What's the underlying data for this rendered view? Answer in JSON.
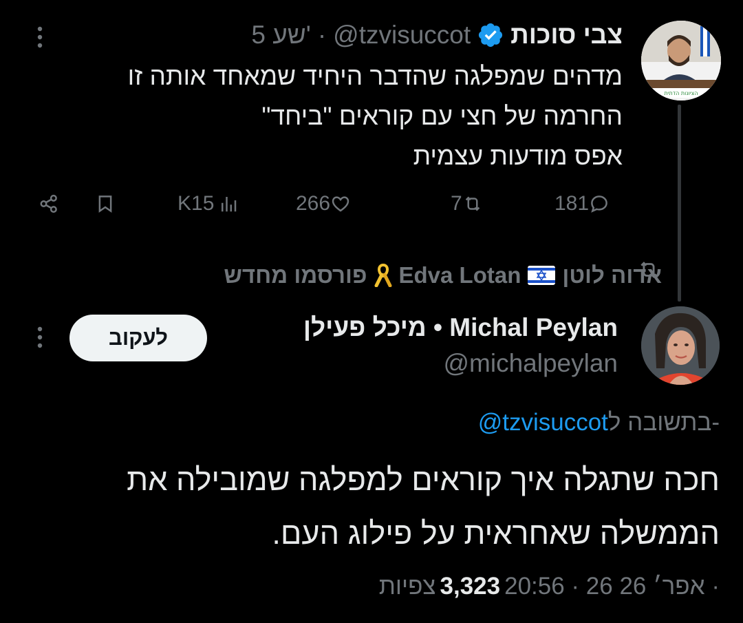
{
  "tweet1": {
    "author_name": "צבי סוכות",
    "handle": "@tzvisuccot",
    "time": "5 שע'",
    "separator": "·",
    "avatar_icon": "person-avatar",
    "verified_icon": "verified-badge-icon",
    "body_lines": [
      "מדהים שמפלגה שהדבר היחיד שמאחד אותה זו",
      "החרמה של חצי עם קוראים \"ביחד\"",
      "אפס מודעות עצמית"
    ],
    "actions": {
      "replies": "181",
      "retweets": "7",
      "likes": "266",
      "views": "K15"
    }
  },
  "repost_banner": {
    "text_he": "אדוה לוטן",
    "text_en": "Edva Lotan",
    "suffix": "פורסמו מחדש",
    "flag_icon": "israel-flag-icon",
    "ribbon_icon": "yellow-ribbon-icon"
  },
  "tweet2": {
    "author_name": "מיכל פעילן • Michal Peylan",
    "handle": "@michalpeylan",
    "follow_label": "לעקוב",
    "reply_prefix": "בתשובה ל-",
    "reply_mention": "@tzvisuccot",
    "body_lines": [
      "חכה שתגלה איך קוראים למפלגה שמובילה את",
      "הממשלה שאחראית על פילוג העם."
    ],
    "meta_time": "20:56 · 26 אפר׳ 26 ·",
    "views_count": "3,323",
    "views_label": "צפיות"
  },
  "colors": {
    "background": "#000000",
    "text_primary": "#e7e9ea",
    "text_secondary": "#71767b",
    "accent_blue": "#1d9bf0",
    "follow_bg": "#eff3f4"
  }
}
